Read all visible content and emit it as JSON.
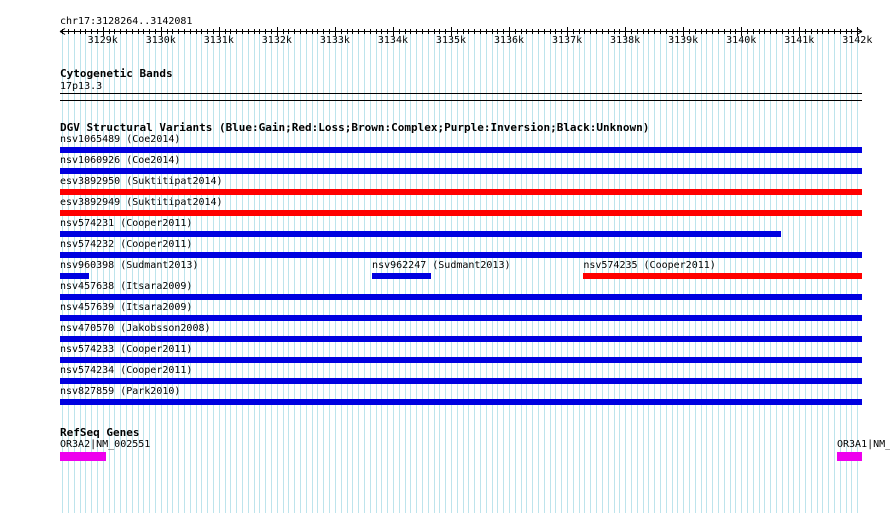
{
  "colors": {
    "gain": "#0000e0",
    "loss": "#ff0000",
    "gene": "#ee00ee",
    "grid": "#bde4ec",
    "axis": "#000000"
  },
  "ruler": {
    "region": "chr17:3128264..3142081",
    "start": 3128264,
    "end": 3142081,
    "ticks": [
      {
        "pos": 3129000,
        "label": "3129k"
      },
      {
        "pos": 3130000,
        "label": "3130k"
      },
      {
        "pos": 3131000,
        "label": "3131k"
      },
      {
        "pos": 3132000,
        "label": "3132k"
      },
      {
        "pos": 3133000,
        "label": "3133k"
      },
      {
        "pos": 3134000,
        "label": "3134k"
      },
      {
        "pos": 3135000,
        "label": "3135k"
      },
      {
        "pos": 3136000,
        "label": "3136k"
      },
      {
        "pos": 3137000,
        "label": "3137k"
      },
      {
        "pos": 3138000,
        "label": "3138k"
      },
      {
        "pos": 3139000,
        "label": "3139k"
      },
      {
        "pos": 3140000,
        "label": "3140k"
      },
      {
        "pos": 3141000,
        "label": "3141k"
      },
      {
        "pos": 3142000,
        "label": "3142k"
      }
    ]
  },
  "cytoband": {
    "title": "Cytogenetic Bands",
    "band": "17p13.3"
  },
  "dgv": {
    "title": "DGV Structural Variants (Blue:Gain;Red:Loss;Brown:Complex;Purple:Inversion;Black:Unknown)",
    "rows": [
      [
        {
          "label": "nsv1065489 (Coe2014)",
          "type": "gain",
          "start": 3128264,
          "end": 3142081
        }
      ],
      [
        {
          "label": "nsv1060926 (Coe2014)",
          "type": "gain",
          "start": 3128264,
          "end": 3142081
        }
      ],
      [
        {
          "label": "esv3892950 (Suktitipat2014)",
          "type": "loss",
          "start": 3128264,
          "end": 3142081
        }
      ],
      [
        {
          "label": "esv3892949 (Suktitipat2014)",
          "type": "loss",
          "start": 3128264,
          "end": 3142081
        }
      ],
      [
        {
          "label": "nsv574231 (Cooper2011)",
          "type": "gain",
          "start": 3128264,
          "end": 3140690
        }
      ],
      [
        {
          "label": "nsv574232 (Cooper2011)",
          "type": "gain",
          "start": 3128264,
          "end": 3142081
        }
      ],
      [
        {
          "label": "nsv960398 (Sudmant2013)",
          "type": "gain",
          "start": 3128264,
          "end": 3128760
        },
        {
          "label": "nsv962247 (Sudmant2013)",
          "type": "gain",
          "start": 3133640,
          "end": 3134660
        },
        {
          "label": "nsv574235 (Cooper2011)",
          "type": "loss",
          "start": 3137280,
          "end": 3142081
        }
      ],
      [
        {
          "label": "nsv457638 (Itsara2009)",
          "type": "gain",
          "start": 3128264,
          "end": 3142081
        }
      ],
      [
        {
          "label": "nsv457639 (Itsara2009)",
          "type": "gain",
          "start": 3128264,
          "end": 3142081
        }
      ],
      [
        {
          "label": "nsv470570 (Jakobsson2008)",
          "type": "gain",
          "start": 3128264,
          "end": 3142081
        }
      ],
      [
        {
          "label": "nsv574233 (Cooper2011)",
          "type": "gain",
          "start": 3128264,
          "end": 3142081
        }
      ],
      [
        {
          "label": "nsv574234 (Cooper2011)",
          "type": "gain",
          "start": 3128264,
          "end": 3142081
        }
      ],
      [
        {
          "label": "nsv827859 (Park2010)",
          "type": "gain",
          "start": 3128264,
          "end": 3142081
        }
      ]
    ]
  },
  "refseq": {
    "title": "RefSeq Genes",
    "genes": [
      {
        "label": "OR3A2|NM_002551",
        "start": 3128264,
        "end": 3129050
      },
      {
        "label": "OR3A1|NM_",
        "start": 3141650,
        "end": 3142081
      }
    ]
  }
}
